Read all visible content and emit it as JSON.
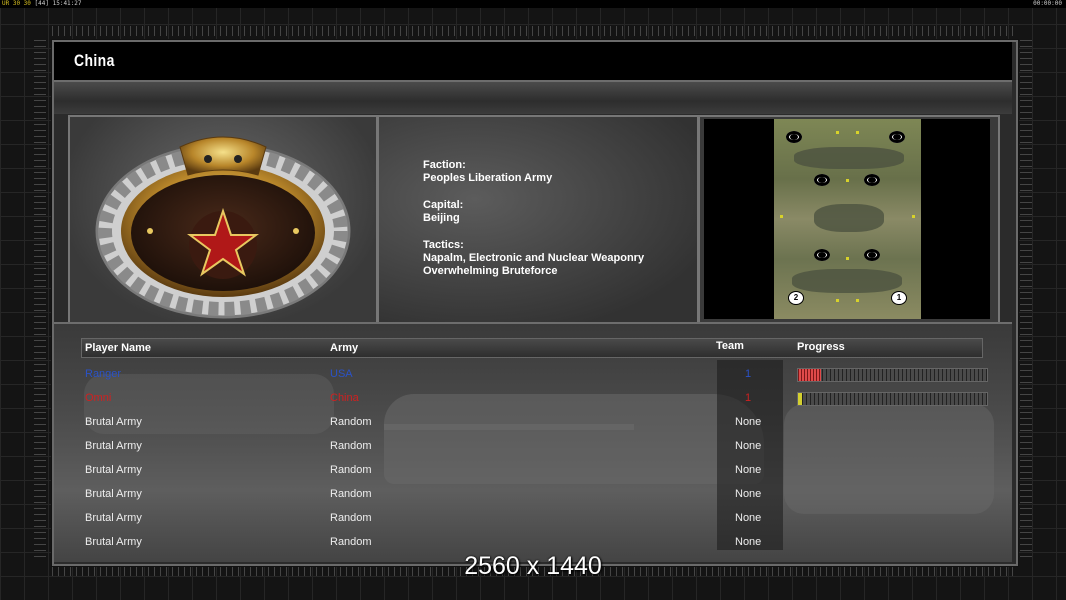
{
  "topbar": {
    "stats": "UR 30 30",
    "stats2": "[44]",
    "clock": "15:41:27",
    "right_clock": "00:00:00"
  },
  "header": {
    "title": "China"
  },
  "faction": {
    "faction_label": "Faction:",
    "faction_value": "Peoples Liberation Army",
    "capital_label": "Capital:",
    "capital_value": "Beijing",
    "tactics_label": "Tactics:",
    "tactics_line1": "Napalm, Electronic and Nuclear Weaponry",
    "tactics_line2": "Overwhelming Bruteforce"
  },
  "map": {
    "start1": "1",
    "start2": "2"
  },
  "table": {
    "headers": {
      "player": "Player Name",
      "army": "Army",
      "team": "Team",
      "progress": "Progress"
    },
    "rows": [
      {
        "name": "Ranger",
        "army": "USA",
        "team": "1",
        "progress": 0.12,
        "color": "#2a52c8"
      },
      {
        "name": "Omni",
        "army": "China",
        "team": "1",
        "progress": 0.02,
        "color": "#d02020"
      },
      {
        "name": "Brutal Army",
        "army": "Random",
        "team": "None"
      },
      {
        "name": "Brutal Army",
        "army": "Random",
        "team": "None"
      },
      {
        "name": "Brutal Army",
        "army": "Random",
        "team": "None"
      },
      {
        "name": "Brutal Army",
        "army": "Random",
        "team": "None"
      },
      {
        "name": "Brutal Army",
        "army": "Random",
        "team": "None"
      },
      {
        "name": "Brutal Army",
        "army": "Random",
        "team": "None"
      }
    ]
  },
  "watermark": "2560 x 1440",
  "colors": {
    "player_blue": "#2a52c8",
    "player_red": "#d02020",
    "progress_red": "#e04a4a",
    "progress_yellow": "#d4d030"
  }
}
